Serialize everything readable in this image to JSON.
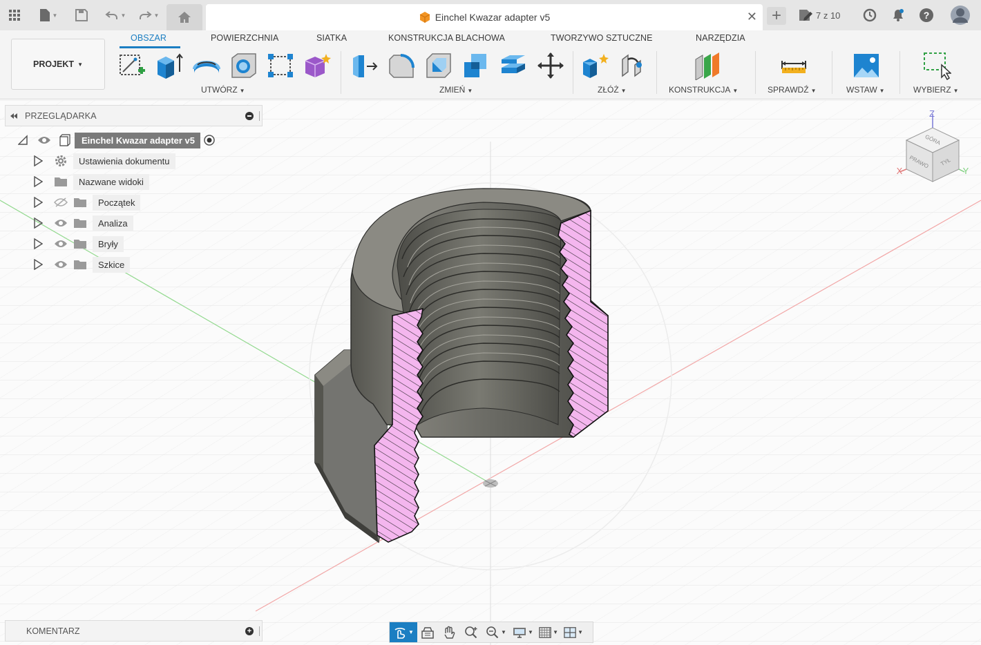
{
  "window": {
    "title": "Einchel Kwazar adapter v5",
    "jobs_counter": "7 z 10"
  },
  "icons": {
    "top": [
      "grid-icon",
      "file-icon",
      "save-icon",
      "undo-icon",
      "redo-icon",
      "home-icon",
      "close-icon",
      "plus-icon",
      "job-status-icon",
      "clock-icon",
      "notifications-icon",
      "help-icon",
      "user-avatar-icon"
    ],
    "ribbon": [
      "create-sketch-icon",
      "extrude-icon",
      "revolve-icon",
      "hole-icon",
      "rectangular-pattern-icon",
      "create-form-icon",
      "press-pull-icon",
      "fillet-icon",
      "shell-icon",
      "combine-icon",
      "offset-face-icon",
      "move-icon",
      "new-component-icon",
      "joint-icon",
      "offset-plane-icon",
      "measure-icon",
      "insert-image-icon",
      "select-icon"
    ],
    "navigation": [
      "orbit-icon",
      "look-at-icon",
      "pan-icon",
      "zoom-icon",
      "zoom-window-icon",
      "display-settings-icon",
      "grid-settings-icon",
      "viewports-icon"
    ]
  },
  "ribbon": {
    "project_label": "PROJEKT",
    "tabs": [
      {
        "label": "OBSZAR",
        "active": true
      },
      {
        "label": "POWIERZCHNIA",
        "active": false
      },
      {
        "label": "SIATKA",
        "active": false
      },
      {
        "label": "KONSTRUKCJA BLACHOWA",
        "active": false
      },
      {
        "label": "TWORZYWO SZTUCZNE",
        "active": false
      },
      {
        "label": "NARZĘDZIA",
        "active": false
      }
    ],
    "groups": [
      "UTWÓRZ",
      "ZMIEŃ",
      "ZŁÓŻ",
      "KONSTRUKCJA",
      "SPRAWDŹ",
      "WSTAW",
      "WYBIERZ"
    ]
  },
  "browser": {
    "title": "PRZEGLĄDARKA",
    "root": "Einchel Kwazar adapter v5",
    "items": [
      {
        "label": "Ustawienia dokumentu",
        "icon": "gear-icon"
      },
      {
        "label": "Nazwane widoki",
        "icon": "folder-icon"
      },
      {
        "label": "Początek",
        "icon": "folder-icon",
        "visible": false
      },
      {
        "label": "Analiza",
        "icon": "folder-icon",
        "visible": true
      },
      {
        "label": "Bryły",
        "icon": "folder-icon",
        "visible": true
      },
      {
        "label": "Szkice",
        "icon": "folder-icon",
        "visible": true
      }
    ]
  },
  "viewcube": {
    "top": "GÓRA",
    "front": "PRAWO",
    "right": "TYŁ",
    "axis_z": "Z",
    "axis_x": "X",
    "axis_y": "Y"
  },
  "comments": {
    "title": "KOMENTARZ"
  },
  "colors": {
    "accent": "#1b7ec2",
    "section_fill": "#f4b6ee",
    "body": "#6b6b66"
  }
}
